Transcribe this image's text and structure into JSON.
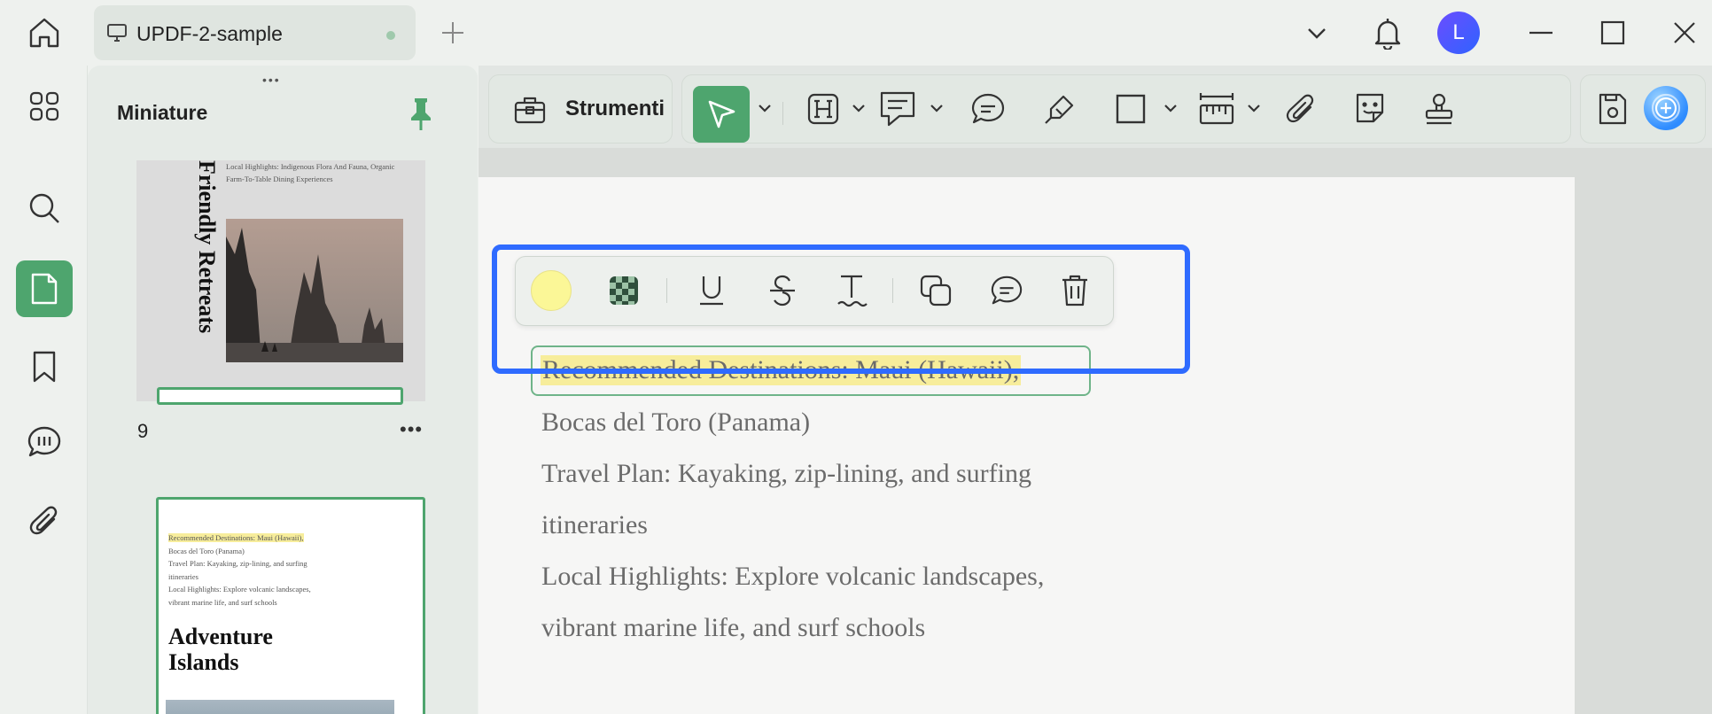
{
  "tab": {
    "title": "UPDF-2-sample"
  },
  "user": {
    "initial": "L"
  },
  "sidebar": {
    "title": "Miniature",
    "thumbnails": [
      {
        "page": "9",
        "vertical_title": "Friendly Retreats",
        "caption": "Local Highlights: Indigenous Flora And Fauna, Organic Farm-To-Table Dining Experiences"
      },
      {
        "lines": [
          "Recommended Destinations: Maui (Hawaii),",
          "Bocas del Toro (Panama)",
          "Travel Plan: Kayaking, zip-lining, and surfing",
          "itineraries",
          "Local Highlights: Explore volcanic landscapes,",
          "vibrant marine life, and surf schools"
        ],
        "heading": "Adventure Islands"
      }
    ]
  },
  "toolbar": {
    "tools_label": "Strumenti"
  },
  "document": {
    "highlighted": "Recommended Destinations: Maui (Hawaii),",
    "lines": [
      "Bocas del Toro (Panama)",
      "Travel Plan: Kayaking, zip-lining, and surfing",
      "itineraries",
      "Local Highlights: Explore volcanic landscapes,",
      "vibrant marine life, and surf schools"
    ]
  },
  "colors": {
    "accent_green": "#4ea56e",
    "focus_blue": "#2f6bff",
    "highlight_yellow": "#f7ed9b"
  },
  "icons": [
    "home-icon",
    "monitor-icon",
    "plus-icon",
    "chevron-down-icon",
    "bell-icon",
    "minimize-icon",
    "maximize-icon",
    "close-icon",
    "grid-icon",
    "search-icon",
    "page-icon",
    "bookmark-icon",
    "comment-icon",
    "paperclip-icon",
    "pin-icon",
    "toolbox-icon",
    "cursor-icon",
    "heading-icon",
    "text-comment-icon",
    "speech-icon",
    "pen-icon",
    "rectangle-icon",
    "ruler-icon",
    "sticker-icon",
    "stamp-icon",
    "save-icon",
    "ai-assistant-icon",
    "underline-icon",
    "strikethrough-icon",
    "squiggly-icon",
    "copy-icon",
    "trash-icon"
  ]
}
